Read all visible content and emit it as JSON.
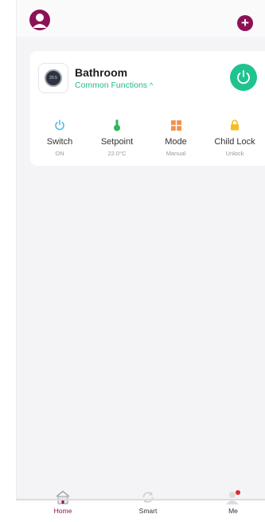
{
  "device": {
    "name": "Bathroom",
    "subtitle": "Common Functions",
    "chevron": "^",
    "icon": "thermostat-icon",
    "dial_text": "20.5"
  },
  "functions": [
    {
      "label": "Switch",
      "value": "ON",
      "icon": "power-icon",
      "color": "#4fb6ea"
    },
    {
      "label": "Setpoint",
      "value": "22.0°C",
      "icon": "thermometer-icon",
      "color": "#2fb65a"
    },
    {
      "label": "Mode",
      "value": "Manual",
      "icon": "grid-icon",
      "color": "#f0934f"
    },
    {
      "label": "Child Lock",
      "value": "Unlock",
      "icon": "lock-icon",
      "color": "#f6bd1f"
    }
  ],
  "tabs": [
    {
      "label": "Home",
      "icon": "home-icon"
    },
    {
      "label": "Smart",
      "icon": "refresh-icon"
    },
    {
      "label": "Me",
      "icon": "person-icon"
    }
  ],
  "colors": {
    "brand": "#8c1256",
    "accent": "#1fc38f",
    "background": "#f4f4f6"
  }
}
